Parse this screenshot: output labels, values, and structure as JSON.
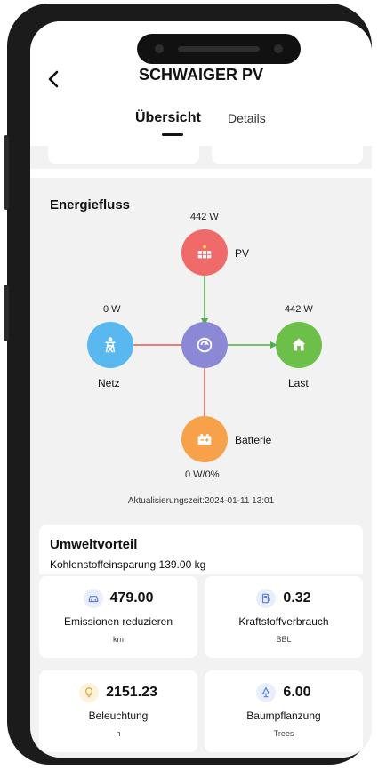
{
  "header": {
    "back_icon": "chevron-left-icon",
    "title": "SCHWAIGER PV",
    "tabs": [
      {
        "label": "Übersicht",
        "active": true
      },
      {
        "label": "Details",
        "active": false
      }
    ]
  },
  "energy": {
    "title": "Energiefluss",
    "pv": {
      "label": "PV",
      "power": "442 W",
      "color": "#f06a6a",
      "icon": "solar-panel-icon"
    },
    "grid": {
      "label": "Netz",
      "power": "0 W",
      "color": "#5ab8f0",
      "icon": "power-tower-icon"
    },
    "load": {
      "label": "Last",
      "power": "442 W",
      "color": "#6cc04a",
      "icon": "house-icon"
    },
    "battery": {
      "label": "Batterie",
      "power": "0 W/0%",
      "color": "#f7a14a",
      "icon": "battery-icon"
    },
    "inverter": {
      "color": "#8b89d6",
      "icon": "inverter-icon"
    },
    "updated": "Aktualisierungszeit:2024-01-11 13:01",
    "flow_colors": {
      "active": "#4caf50",
      "inactive": "#e25b4f"
    }
  },
  "environment": {
    "title": "Umweltvorteil",
    "carbon": "Kohlenstoffeinsparung 139.00 kg",
    "cards": [
      {
        "value": "479.00",
        "name": "Emissionen reduzieren",
        "unit": "km",
        "icon": "car-icon"
      },
      {
        "value": "0.32",
        "name": "Kraftstoffverbrauch",
        "unit": "BBL",
        "icon": "fuel-icon"
      },
      {
        "value": "2151.23",
        "name": "Beleuchtung",
        "unit": "h",
        "icon": "lightbulb-icon"
      },
      {
        "value": "6.00",
        "name": "Baumpflanzung",
        "unit": "Trees",
        "icon": "tree-icon"
      }
    ]
  }
}
